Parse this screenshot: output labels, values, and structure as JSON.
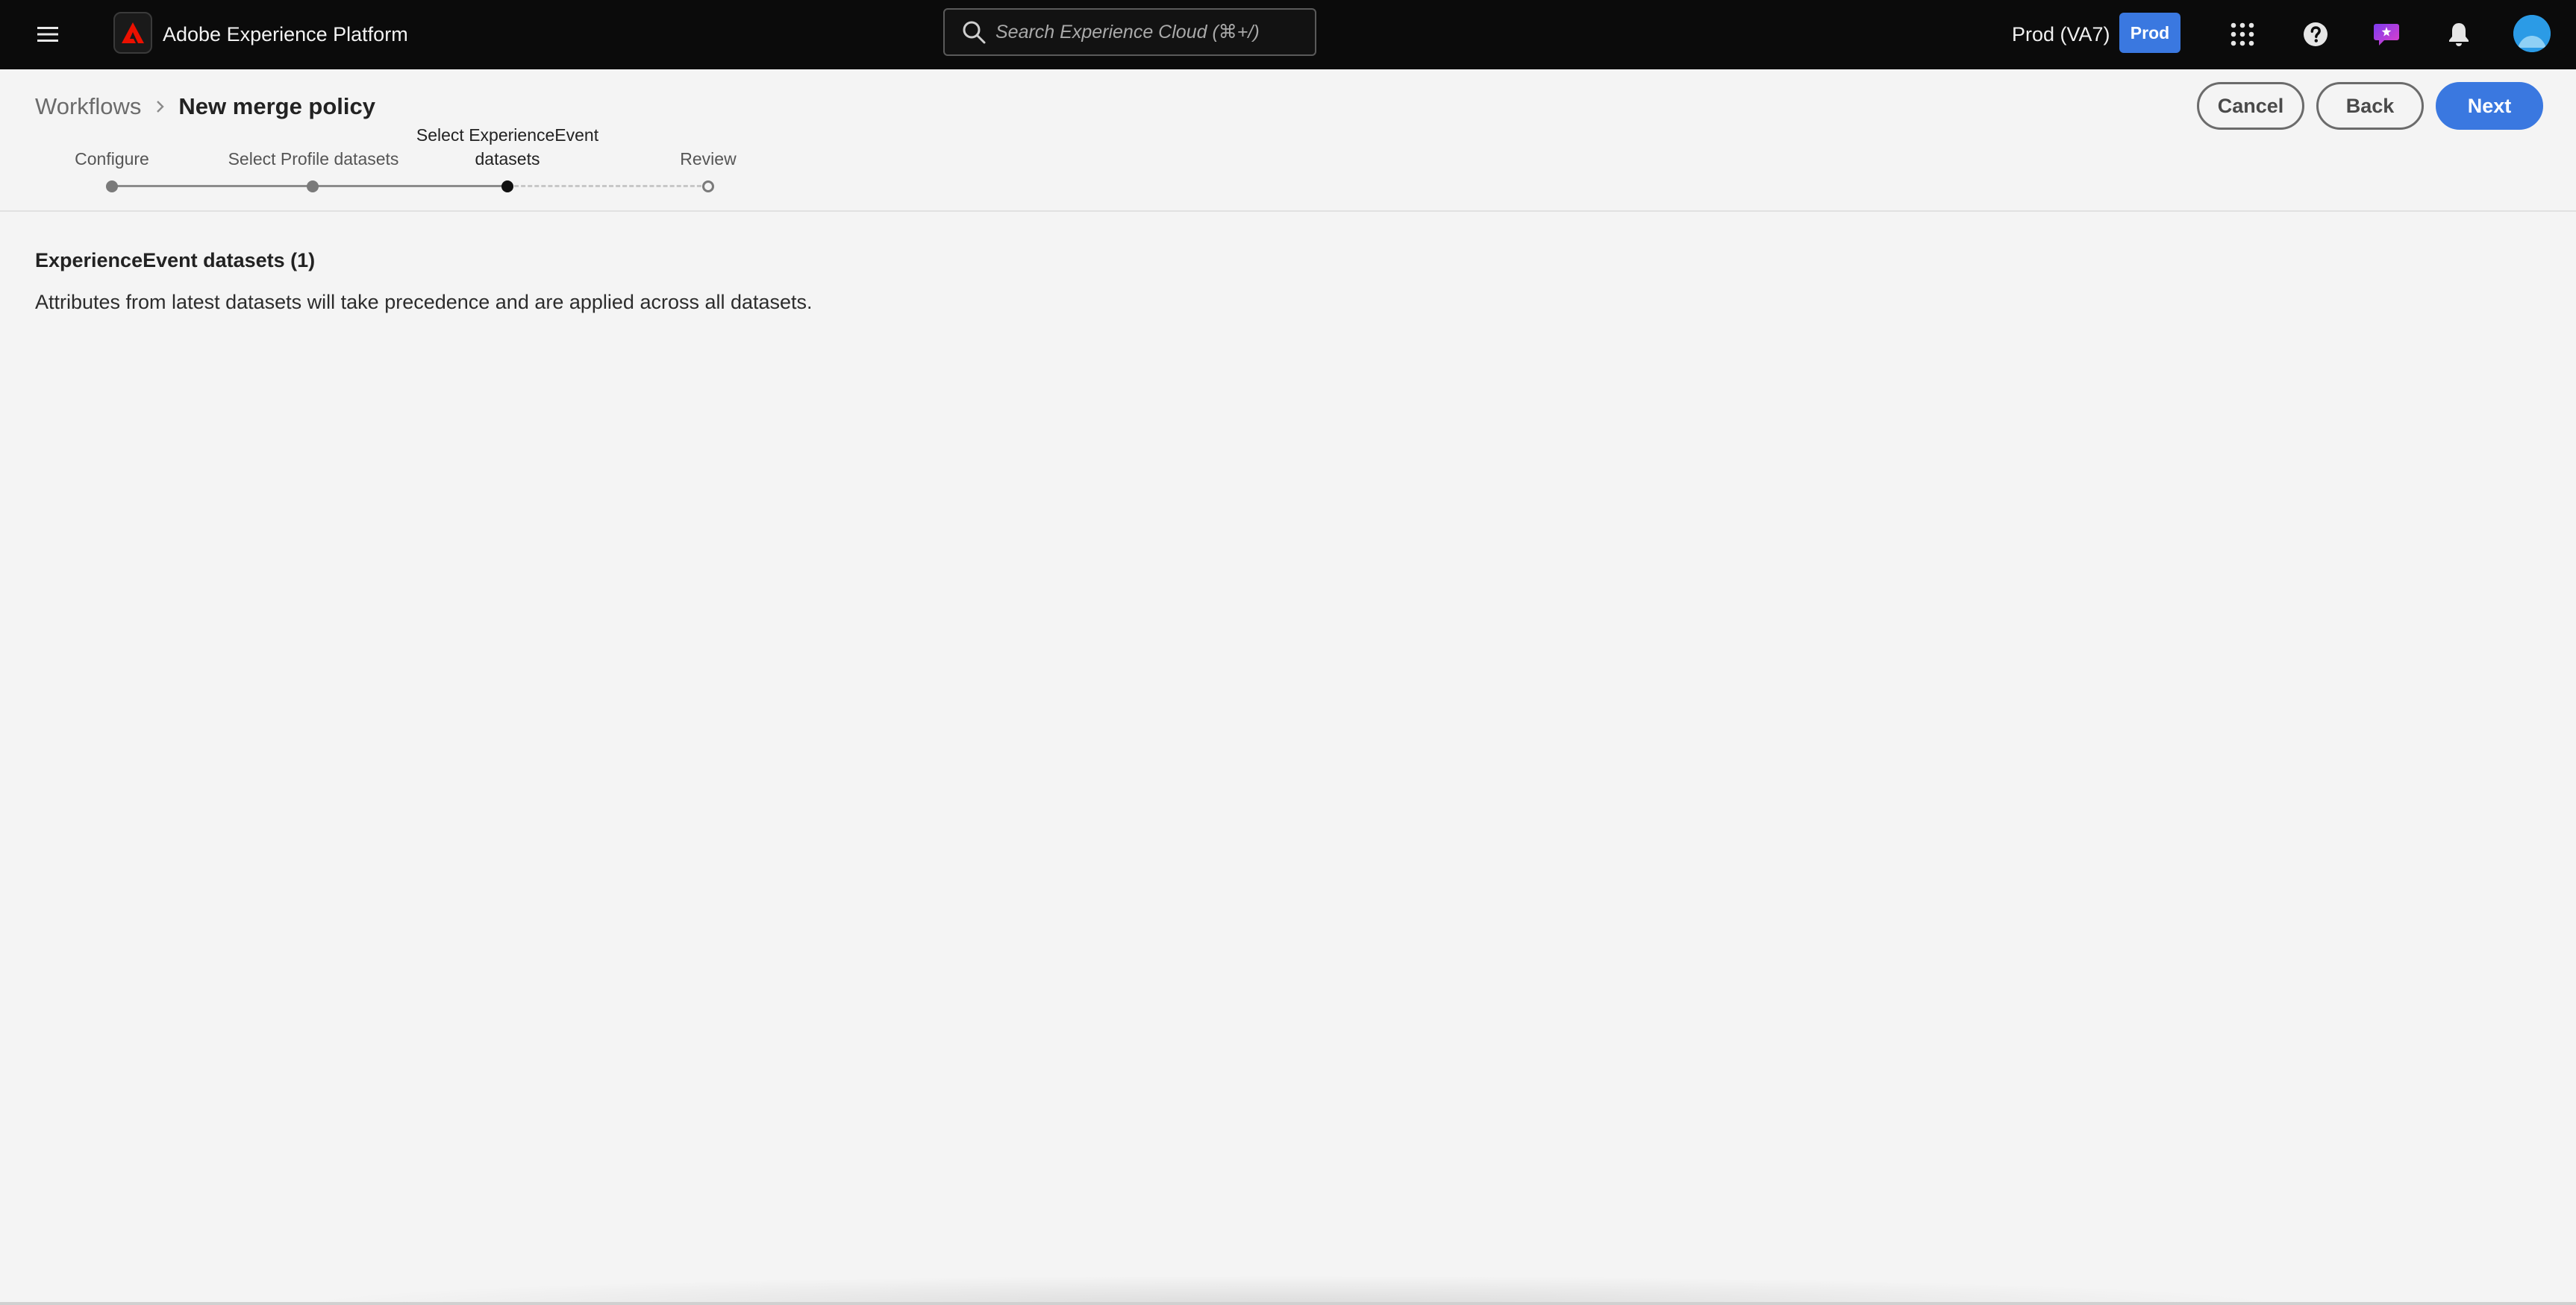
{
  "header": {
    "app_title": "Adobe Experience Platform",
    "search_placeholder": "Search Experience Cloud (⌘+/)",
    "org_name": "Prod (VA7)",
    "env_badge": "Prod",
    "icons": [
      "menu-icon",
      "adobe-logo-icon",
      "search-icon",
      "apps-grid-icon",
      "help-icon",
      "feedback-icon",
      "bell-icon",
      "avatar"
    ]
  },
  "breadcrumb": {
    "parent": "Workflows",
    "current": "New merge policy"
  },
  "actions": {
    "cancel": "Cancel",
    "back": "Back",
    "next": "Next"
  },
  "stepper": {
    "steps": [
      {
        "label_line1": "",
        "label_line2": "Configure",
        "state": "complete"
      },
      {
        "label_line1": "",
        "label_line2": "Select Profile datasets",
        "state": "complete"
      },
      {
        "label_line1": "Select ExperienceEvent",
        "label_line2": "datasets",
        "state": "current"
      },
      {
        "label_line1": "",
        "label_line2": "Review",
        "state": "upcoming"
      }
    ]
  },
  "content": {
    "section_title": "ExperienceEvent datasets (1)",
    "section_description": "Attributes from latest datasets will take precedence and are applied across all datasets."
  },
  "colors": {
    "topbar_bg": "#0b0b0b",
    "accent_blue": "#3a78e0",
    "brand_red": "#eb1000",
    "page_bg": "#f4f4f4",
    "feedback_purple": "#c046e6"
  }
}
